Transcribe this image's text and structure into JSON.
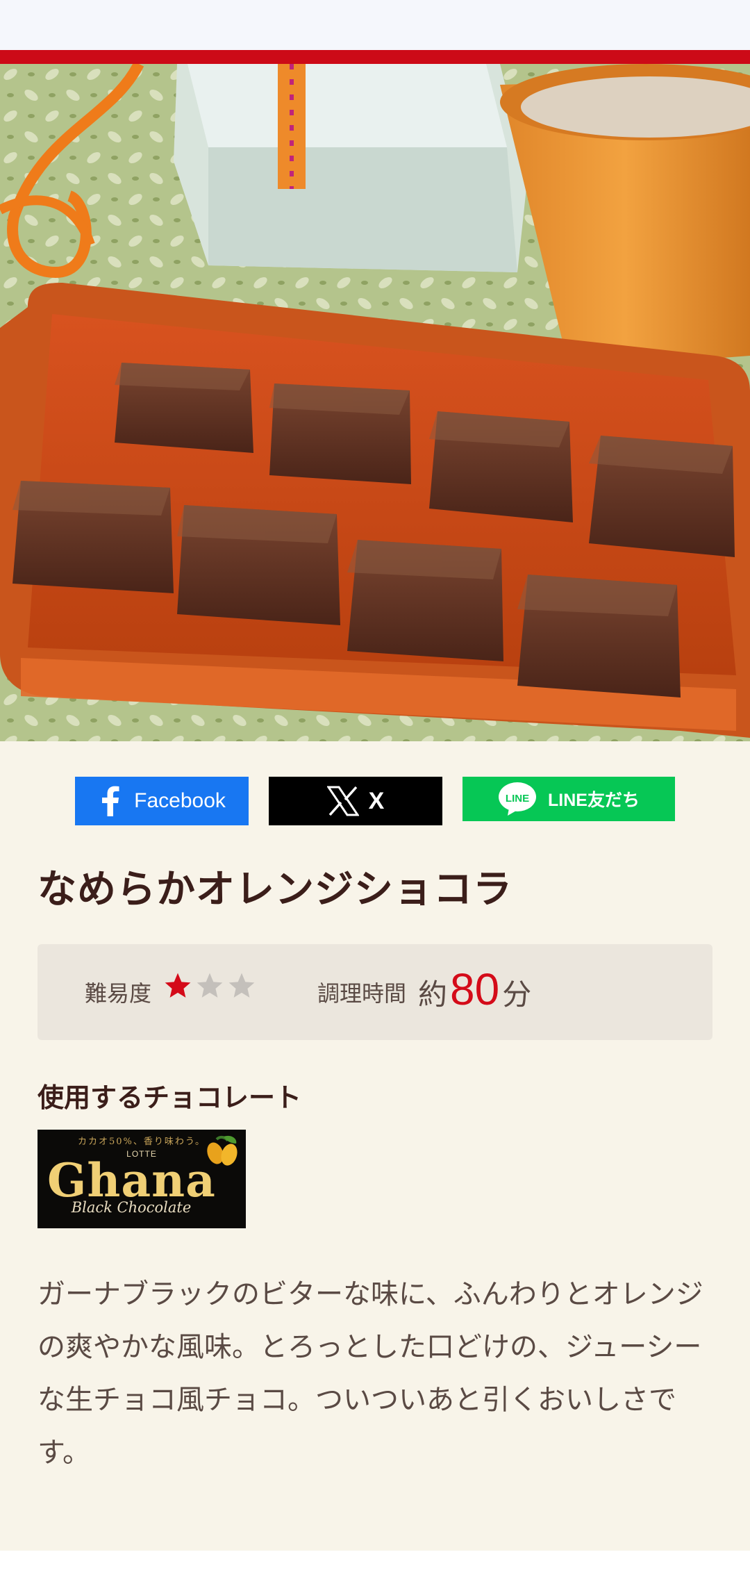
{
  "share": {
    "facebook_label": "Facebook",
    "x_label": "X",
    "line_logo_text": "LINE",
    "line_label": "LINE友だち"
  },
  "recipe": {
    "title": "なめらかオレンジショコラ",
    "difficulty_label": "難易度",
    "difficulty_rating": 1,
    "difficulty_max": 3,
    "time_label": "調理時間",
    "time_approx": "約",
    "time_minutes": "80",
    "time_unit": "分",
    "chocolate_heading": "使用するチョコレート",
    "description": "ガーナブラックのビターな味に、ふんわりとオレンジの爽やかな風味。とろっとした口どけの、ジューシーな生チョコ風チョコ。ついついあと引くおいしさです。"
  },
  "product": {
    "tagline": "カカオ50%、香り味わう。",
    "maker": "LOTTE",
    "name": "Ghana",
    "variant": "Black Chocolate"
  },
  "colors": {
    "accent_red": "#cc0a17",
    "star_active": "#d40b19",
    "star_inactive": "#c4c0bb",
    "facebook_blue": "#1877f2",
    "line_green": "#06c755"
  }
}
